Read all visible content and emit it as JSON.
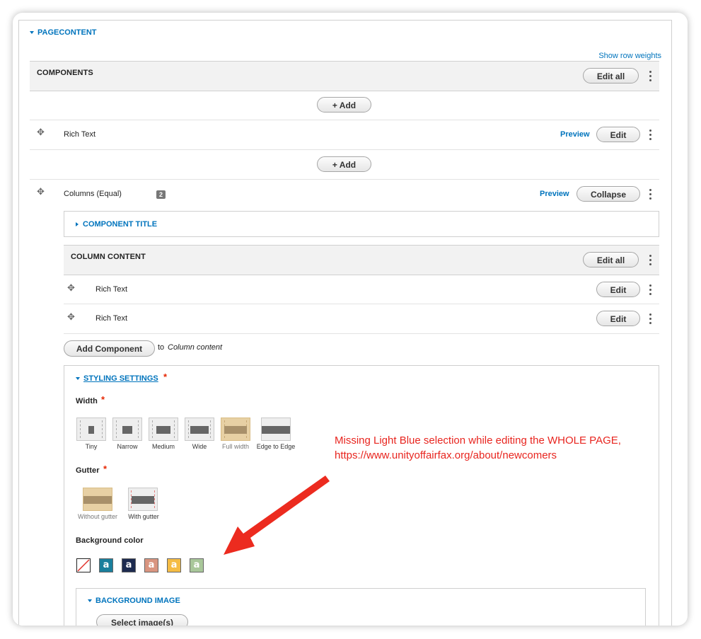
{
  "page_content": {
    "toggle_label": "PAGECONTENT",
    "show_row_weights": "Show row weights",
    "components_header": "COMPONENTS",
    "edit_all": "Edit all",
    "add": "+ Add",
    "rows": [
      {
        "label": "Rich Text",
        "preview": "Preview",
        "action": "Edit"
      },
      {
        "label": "Columns (Equal)",
        "badge": "2",
        "preview": "Preview",
        "action": "Collapse"
      }
    ]
  },
  "columns": {
    "component_title": "COMPONENT TITLE",
    "column_content_header": "COLUMN CONTENT",
    "edit_all": "Edit all",
    "rows": [
      {
        "label": "Rich Text",
        "action": "Edit"
      },
      {
        "label": "Rich Text",
        "action": "Edit"
      }
    ],
    "add_component": "Add Component",
    "to_label": "to",
    "target": "Column content"
  },
  "styling": {
    "title": "STYLING SETTINGS",
    "required_mark": "*",
    "width_label": "Width",
    "width_options": [
      "Tiny",
      "Narrow",
      "Medium",
      "Wide",
      "Full width",
      "Edge to Edge"
    ],
    "width_selected": "Full width",
    "gutter_label": "Gutter",
    "gutter_options": [
      "Without gutter",
      "With gutter"
    ],
    "gutter_selected": "Without gutter",
    "bg_color_label": "Background color",
    "swatch_letter": "a",
    "swatches": [
      {
        "name": "none",
        "color": "#ffffff"
      },
      {
        "name": "teal",
        "color": "#1a7f9c"
      },
      {
        "name": "navy",
        "color": "#1d2b4f"
      },
      {
        "name": "salmon",
        "color": "#d99580"
      },
      {
        "name": "yellow",
        "color": "#f5bc44"
      },
      {
        "name": "sage",
        "color": "#a9c79a"
      }
    ],
    "bg_image_title": "BACKGROUND IMAGE",
    "select_images": "Select image(s)"
  },
  "annotation": {
    "line1": "Missing Light Blue selection while editing the WHOLE PAGE,",
    "line2": "https://www.unityoffairfax.org/about/newcomers",
    "color": "#e8251f"
  }
}
